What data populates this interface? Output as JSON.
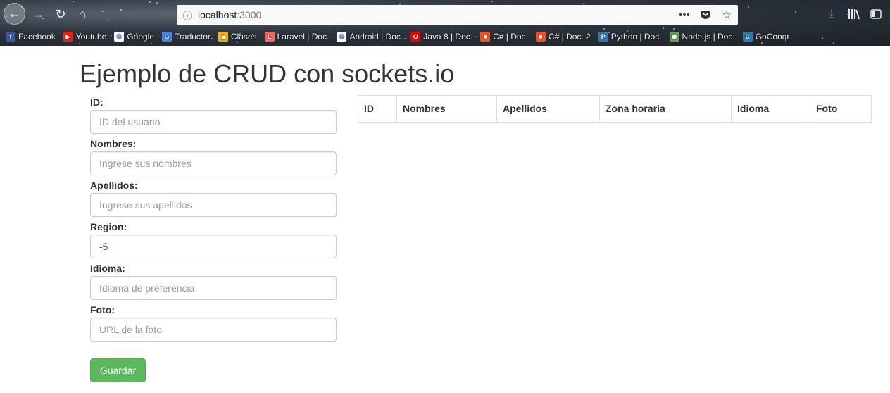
{
  "browser": {
    "url_host": "localhost",
    "url_port": ":3000",
    "bookmarks": [
      {
        "label": "Facebook",
        "icon": "facebook-icon",
        "color": "#3b5998",
        "glyph": "f"
      },
      {
        "label": "Youtube",
        "icon": "youtube-icon",
        "color": "#e62117",
        "glyph": "▶"
      },
      {
        "label": "Google",
        "icon": "google-icon",
        "color": "#ffffff",
        "glyph": "G"
      },
      {
        "label": "Traductor",
        "icon": "translate-icon",
        "color": "#4285f4",
        "glyph": "G"
      },
      {
        "label": "Clases",
        "icon": "classroom-icon",
        "color": "#f4b400",
        "glyph": "▣"
      },
      {
        "label": "Laravel | Doc.",
        "icon": "laravel-icon",
        "color": "#f4645f",
        "glyph": "L"
      },
      {
        "label": "Android | Doc.",
        "icon": "google-icon",
        "color": "#ffffff",
        "glyph": "G"
      },
      {
        "label": "Java 8 | Doc.",
        "icon": "oracle-icon",
        "color": "#e00",
        "glyph": "O"
      },
      {
        "label": "C# | Doc.",
        "icon": "microsoft-icon",
        "color": "#f25022",
        "glyph": "■"
      },
      {
        "label": "C# | Doc. 2",
        "icon": "microsoft-icon",
        "color": "#f25022",
        "glyph": "■"
      },
      {
        "label": "Python | Doc.",
        "icon": "python-icon",
        "color": "#3776ab",
        "glyph": "P"
      },
      {
        "label": "Node.js | Doc.",
        "icon": "nodejs-icon",
        "color": "#68a063",
        "glyph": "⬢"
      },
      {
        "label": "GoConqr",
        "icon": "goconqr-icon",
        "color": "#2a7bb8",
        "glyph": "C"
      }
    ]
  },
  "page": {
    "title": "Ejemplo de CRUD con sockets.io",
    "form": {
      "id_label": "ID:",
      "id_placeholder": "ID del usuario",
      "nombres_label": "Nombres:",
      "nombres_placeholder": "Ingrese sus nombres",
      "apellidos_label": "Apellidos:",
      "apellidos_placeholder": "Ingrese sus apellidos",
      "region_label": "Region:",
      "region_value": "-5",
      "idioma_label": "Idioma:",
      "idioma_placeholder": "Idioma de preferencia",
      "foto_label": "Foto:",
      "foto_placeholder": "URL de la foto",
      "save_label": "Guardar"
    },
    "table": {
      "headers": [
        "ID",
        "Nombres",
        "Apellidos",
        "Zona horaria",
        "Idioma",
        "Foto"
      ]
    }
  }
}
